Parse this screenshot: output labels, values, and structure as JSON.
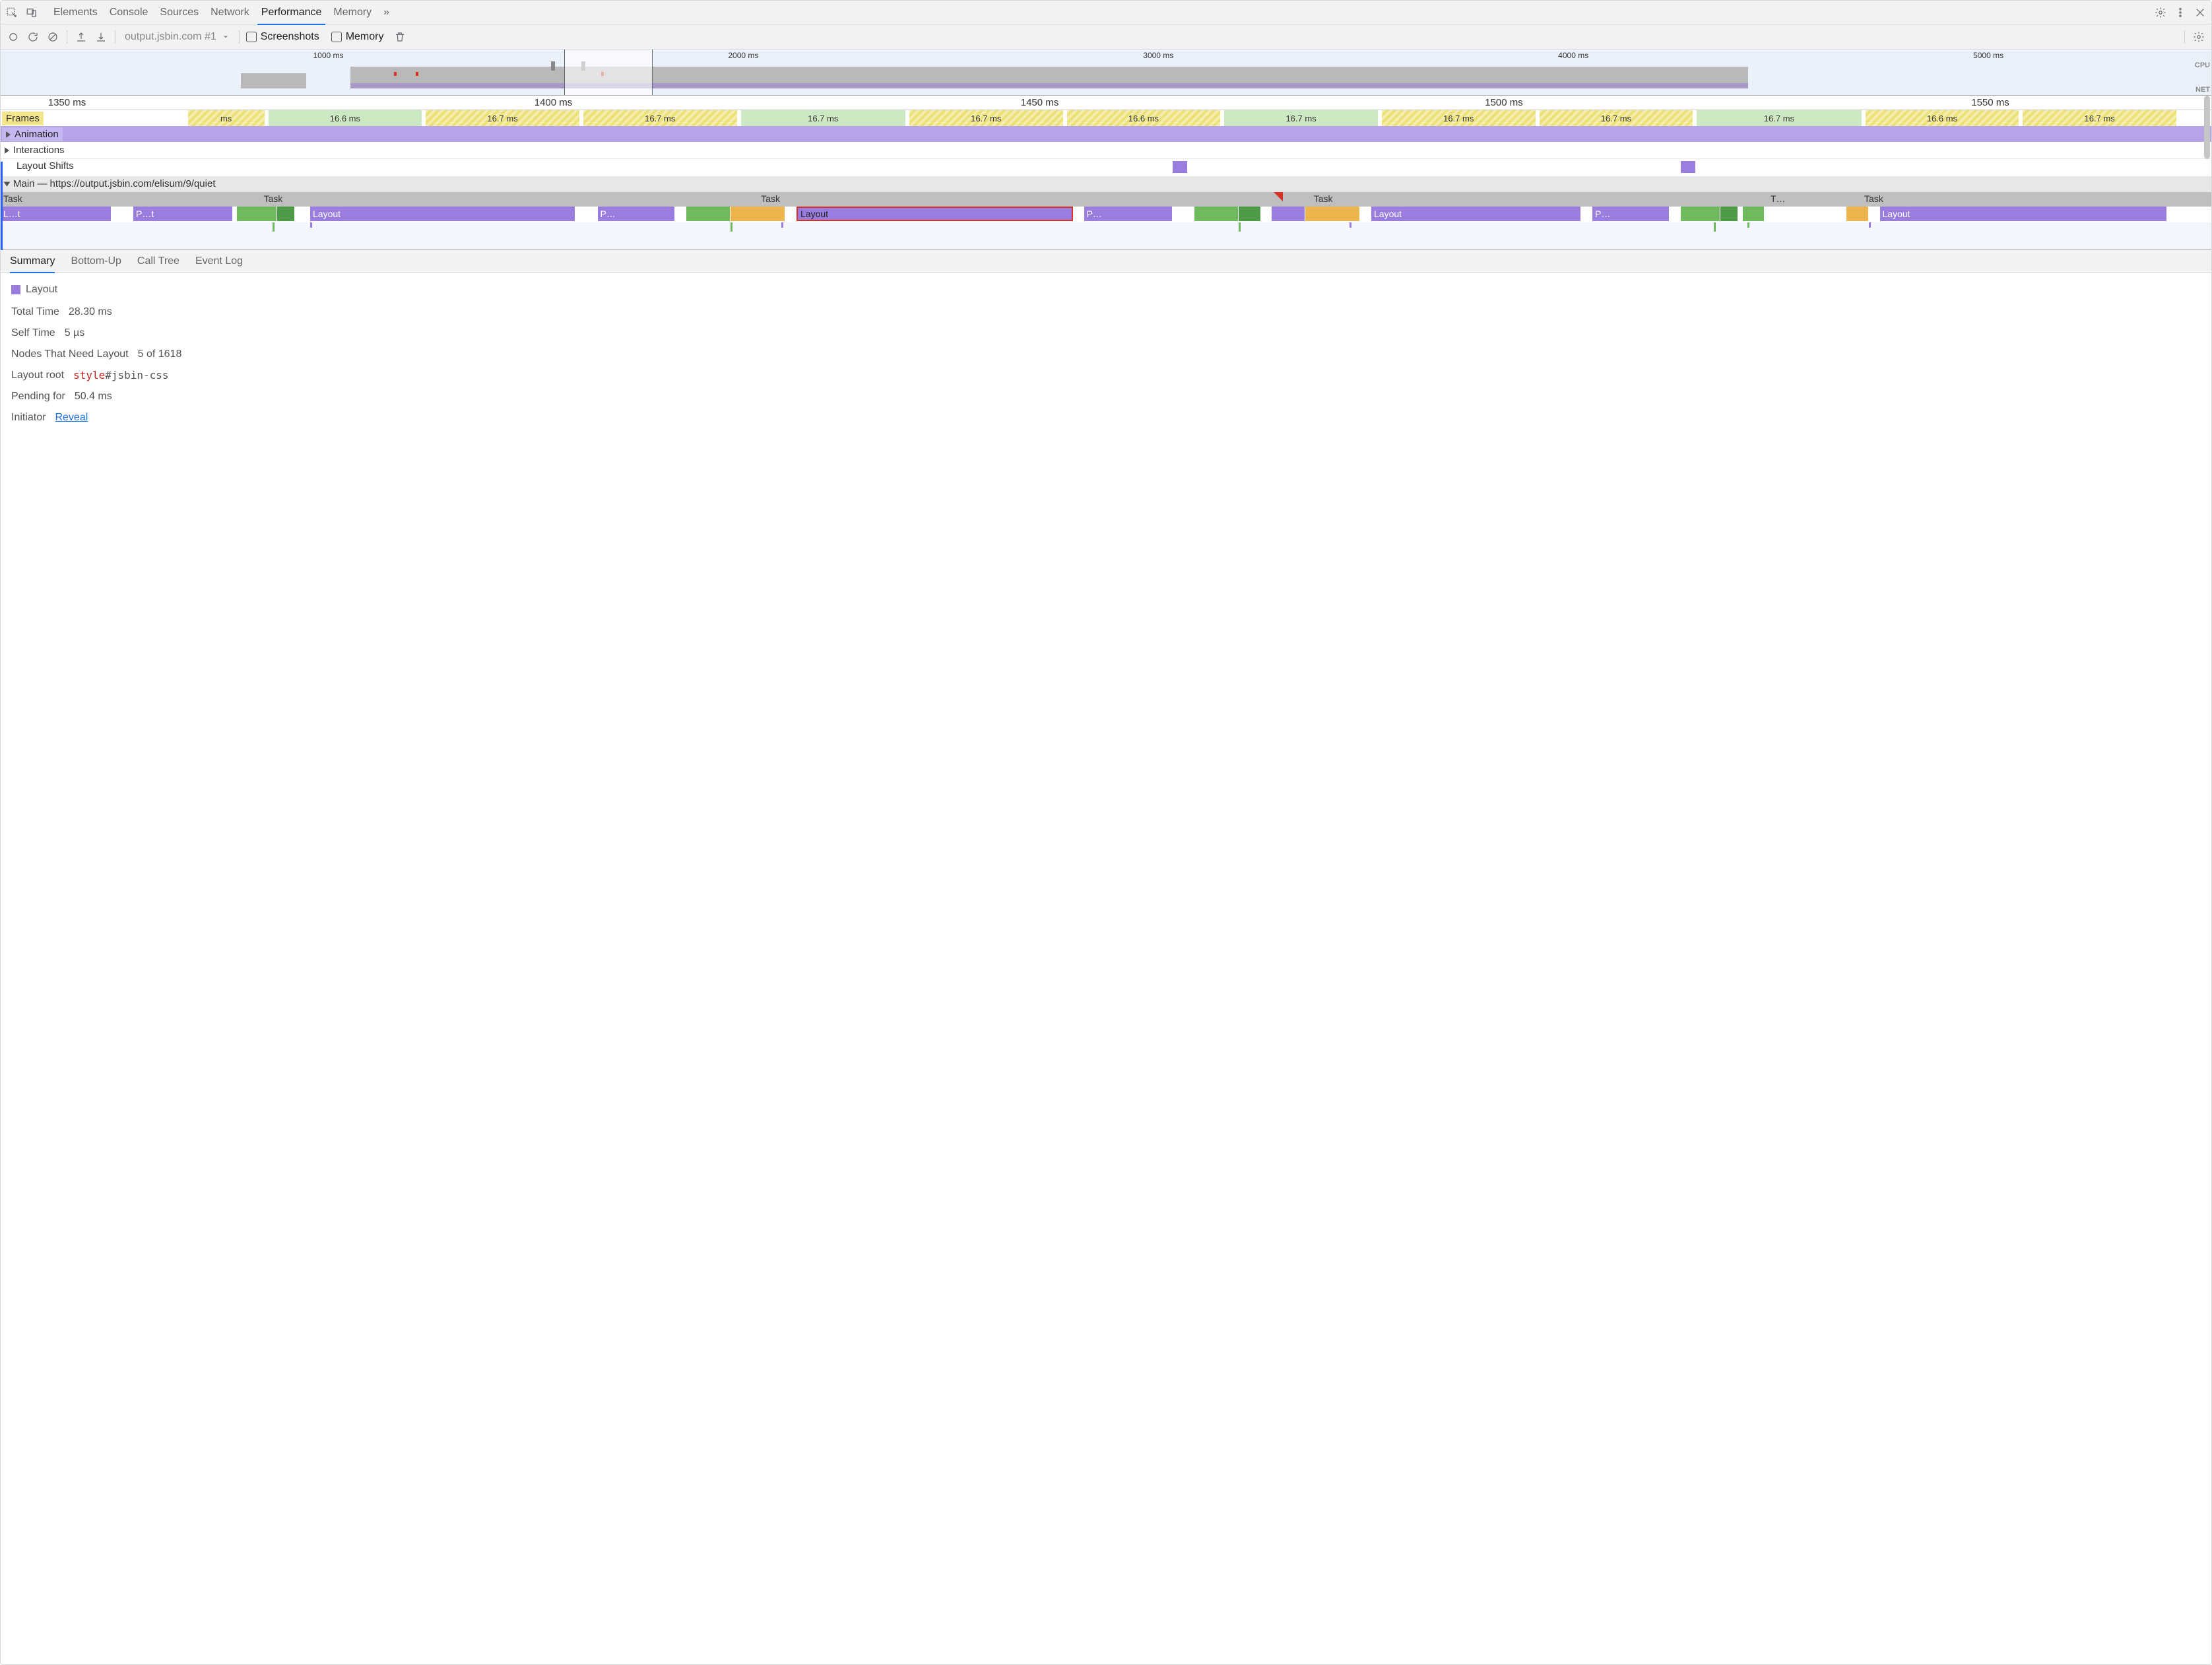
{
  "tabs": {
    "items": [
      "Elements",
      "Console",
      "Sources",
      "Network",
      "Performance",
      "Memory"
    ],
    "active": "Performance",
    "overflow": "»"
  },
  "toolbar": {
    "dropdown": "output.jsbin.com #1",
    "screenshots_label": "Screenshots",
    "memory_label": "Memory"
  },
  "overview": {
    "ticks": [
      "1000 ms",
      "2000 ms",
      "3000 ms",
      "4000 ms",
      "5000 ms"
    ],
    "side": {
      "cpu": "CPU",
      "net": "NET"
    }
  },
  "detail_ruler": [
    "1350 ms",
    "1400 ms",
    "1450 ms",
    "1500 ms",
    "1550 ms"
  ],
  "rows": {
    "frames": {
      "label": "Frames",
      "items": [
        {
          "t": "ms",
          "c": "yellow-d",
          "w": 3.5
        },
        {
          "t": "16.6 ms",
          "c": "green",
          "w": 7
        },
        {
          "t": "16.7 ms",
          "c": "yellow-d",
          "w": 7
        },
        {
          "t": "16.7 ms",
          "c": "yellow-d",
          "w": 7
        },
        {
          "t": "16.7 ms",
          "c": "green",
          "w": 7.5
        },
        {
          "t": "16.7 ms",
          "c": "yellow-d",
          "w": 7
        },
        {
          "t": "16.6 ms",
          "c": "yellow-d",
          "w": 7
        },
        {
          "t": "16.7 ms",
          "c": "green",
          "w": 7
        },
        {
          "t": "16.7 ms",
          "c": "yellow-d",
          "w": 7
        },
        {
          "t": "16.7 ms",
          "c": "yellow-d",
          "w": 7
        },
        {
          "t": "16.7 ms",
          "c": "green",
          "w": 7.5
        },
        {
          "t": "16.6 ms",
          "c": "yellow-d",
          "w": 7
        },
        {
          "t": "16.7 ms",
          "c": "yellow-d",
          "w": 7
        }
      ]
    },
    "animation": "Animation",
    "interactions": "Interactions",
    "layout_shifts": "Layout Shifts",
    "main_label": "Main",
    "main_url": "https://output.jsbin.com/elisum/9/quiet",
    "tasks": [
      "Task",
      "Task",
      "Task",
      "Task",
      "T…",
      "Task"
    ],
    "flame": {
      "blocks": [
        {
          "t": "L…t",
          "c": "c-purple",
          "l": 0,
          "w": 5
        },
        {
          "t": "P…t",
          "c": "c-purple",
          "l": 6,
          "w": 4.5
        },
        {
          "t": "",
          "c": "c-green",
          "l": 10.7,
          "w": 1.8
        },
        {
          "t": "",
          "c": "c-dgreen",
          "l": 12.5,
          "w": 0.8
        },
        {
          "t": "Layout",
          "c": "c-purple",
          "l": 14,
          "w": 12
        },
        {
          "t": "P…",
          "c": "c-purple",
          "l": 27,
          "w": 3.5
        },
        {
          "t": "",
          "c": "c-green",
          "l": 31,
          "w": 2
        },
        {
          "t": "",
          "c": "c-orange",
          "l": 33,
          "w": 2.5
        },
        {
          "t": "Layout",
          "c": "c-red-outline",
          "l": 36,
          "w": 12.5
        },
        {
          "t": "P…",
          "c": "c-purple",
          "l": 49,
          "w": 4
        },
        {
          "t": "",
          "c": "c-green",
          "l": 54,
          "w": 2
        },
        {
          "t": "",
          "c": "c-dgreen",
          "l": 56,
          "w": 1
        },
        {
          "t": "",
          "c": "c-purple",
          "l": 57.5,
          "w": 1.5
        },
        {
          "t": "",
          "c": "c-orange",
          "l": 59,
          "w": 2.5
        },
        {
          "t": "Layout",
          "c": "c-purple",
          "l": 62,
          "w": 9.5
        },
        {
          "t": "P…",
          "c": "c-purple",
          "l": 72,
          "w": 3.5
        },
        {
          "t": "",
          "c": "c-green",
          "l": 76,
          "w": 1.8
        },
        {
          "t": "",
          "c": "c-dgreen",
          "l": 77.8,
          "w": 0.8
        },
        {
          "t": "",
          "c": "c-green",
          "l": 78.8,
          "w": 1
        },
        {
          "t": "",
          "c": "c-orange",
          "l": 83.5,
          "w": 1
        },
        {
          "t": "Layout",
          "c": "c-purple",
          "l": 85,
          "w": 13
        }
      ]
    }
  },
  "bottom_tabs": [
    "Summary",
    "Bottom-Up",
    "Call Tree",
    "Event Log"
  ],
  "bottom_active": "Summary",
  "summary": {
    "title": "Layout",
    "rows": [
      {
        "k": "Total Time",
        "v": "28.30 ms"
      },
      {
        "k": "Self Time",
        "v": "5 µs"
      },
      {
        "k": "Nodes That Need Layout",
        "v": "5 of 1618"
      }
    ],
    "layout_root_k": "Layout root",
    "layout_root_tag": "style",
    "layout_root_sel": "#jsbin-css",
    "pending_k": "Pending for",
    "pending_v": "50.4 ms",
    "initiator_k": "Initiator",
    "initiator_link": "Reveal"
  }
}
